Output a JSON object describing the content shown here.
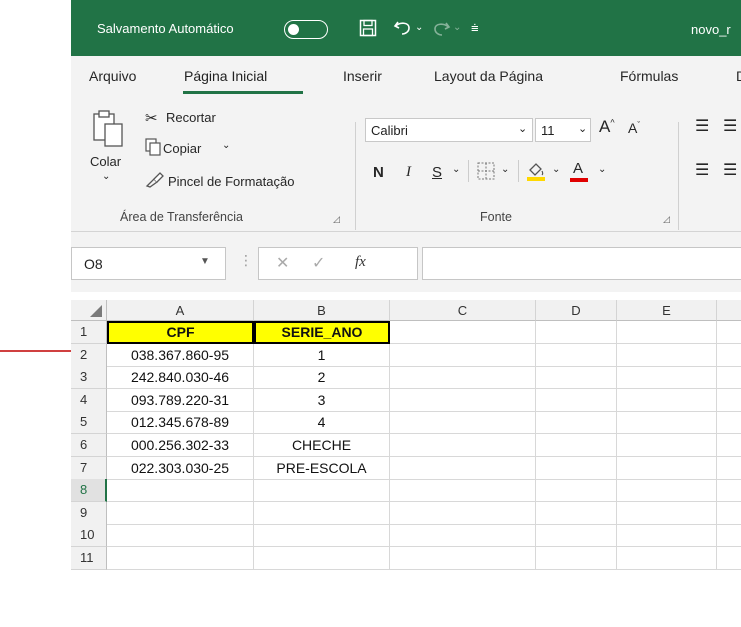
{
  "titlebar": {
    "autosave_label": "Salvamento Automático",
    "filename": "novo_r"
  },
  "tabs": [
    {
      "label": "Arquivo"
    },
    {
      "label": "Página Inicial"
    },
    {
      "label": "Inserir"
    },
    {
      "label": "Layout da Página"
    },
    {
      "label": "Fórmulas"
    },
    {
      "label": "D"
    }
  ],
  "clipboard": {
    "paste": "Colar",
    "cut": "Recortar",
    "copy": "Copiar",
    "format_painter": "Pincel de Formatação",
    "group": "Área de Transferência"
  },
  "font": {
    "name": "Calibri",
    "size": "11",
    "bold": "N",
    "italic": "I",
    "underline": "S",
    "font_color": "A",
    "group": "Fonte"
  },
  "formula_bar": {
    "name_box": "O8",
    "fx": "fx",
    "value": ""
  },
  "columns": [
    "A",
    "B",
    "C",
    "D",
    "E"
  ],
  "rows": [
    {
      "num": "1",
      "a": "CPF",
      "b": "SERIE_ANO"
    },
    {
      "num": "2",
      "a": "038.367.860-95",
      "b": "1"
    },
    {
      "num": "3",
      "a": "242.840.030-46",
      "b": "2"
    },
    {
      "num": "4",
      "a": "093.789.220-31",
      "b": "3"
    },
    {
      "num": "5",
      "a": "012.345.678-89",
      "b": "4"
    },
    {
      "num": "6",
      "a": "000.256.302-33",
      "b": "CHECHE"
    },
    {
      "num": "7",
      "a": "022.303.030-25",
      "b": "PRE-ESCOLA"
    },
    {
      "num": "8",
      "a": "",
      "b": ""
    },
    {
      "num": "9",
      "a": "",
      "b": ""
    },
    {
      "num": "10",
      "a": "",
      "b": ""
    },
    {
      "num": "11",
      "a": "",
      "b": ""
    }
  ],
  "colors": {
    "excel_green": "#217346",
    "header_fill": "#ffff00",
    "annotation_arrow": "#c00000",
    "fill_highlight": "#ffd800",
    "font_color_bar": "#e00000"
  }
}
